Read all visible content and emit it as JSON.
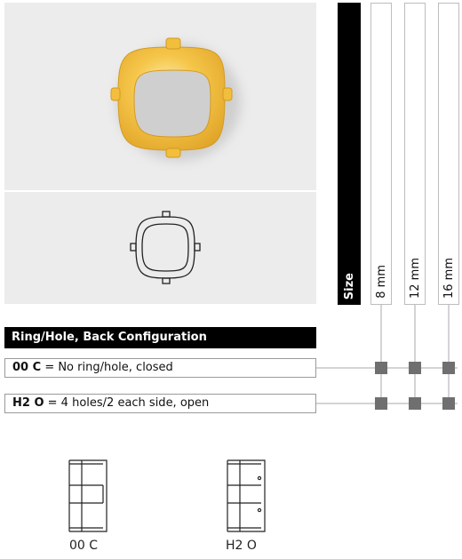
{
  "size_header": "Size",
  "sizes": [
    "8 mm",
    "12 mm",
    "16 mm"
  ],
  "section_title": "Ring/Hole, Back Configuration",
  "options": [
    {
      "code": "00 C",
      "description": "= No ring/hole, closed",
      "available": [
        true,
        true,
        true
      ]
    },
    {
      "code": "H2 O",
      "description": "= 4 holes/2 each side, open",
      "available": [
        true,
        true,
        true
      ]
    }
  ],
  "diagram_captions": [
    "00 C",
    "H2 O"
  ],
  "colors": {
    "gold": "#f2bf3c",
    "panel": "#ececec",
    "marker": "#6f6f6f",
    "header": "#000000"
  }
}
